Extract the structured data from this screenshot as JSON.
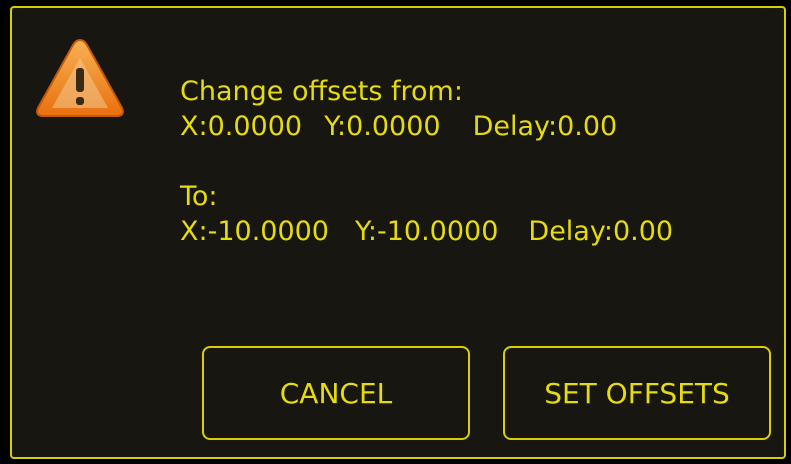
{
  "dialog": {
    "heading": "Change offsets from:",
    "from": {
      "x": "X:0.0000",
      "y": "Y:0.0000",
      "delay": "Delay:0.00"
    },
    "to_label": "To:",
    "to": {
      "x": "X:-10.0000",
      "y": "Y:-10.0000",
      "delay": "Delay:0.00"
    },
    "icon": "warning-icon"
  },
  "buttons": {
    "cancel_label": "CANCEL",
    "set_offsets_label": "SET OFFSETS"
  },
  "colors": {
    "background": "#181611",
    "accent": "#e6dc0a",
    "border": "#d8cf00",
    "warning_orange": "#f08a1c"
  }
}
